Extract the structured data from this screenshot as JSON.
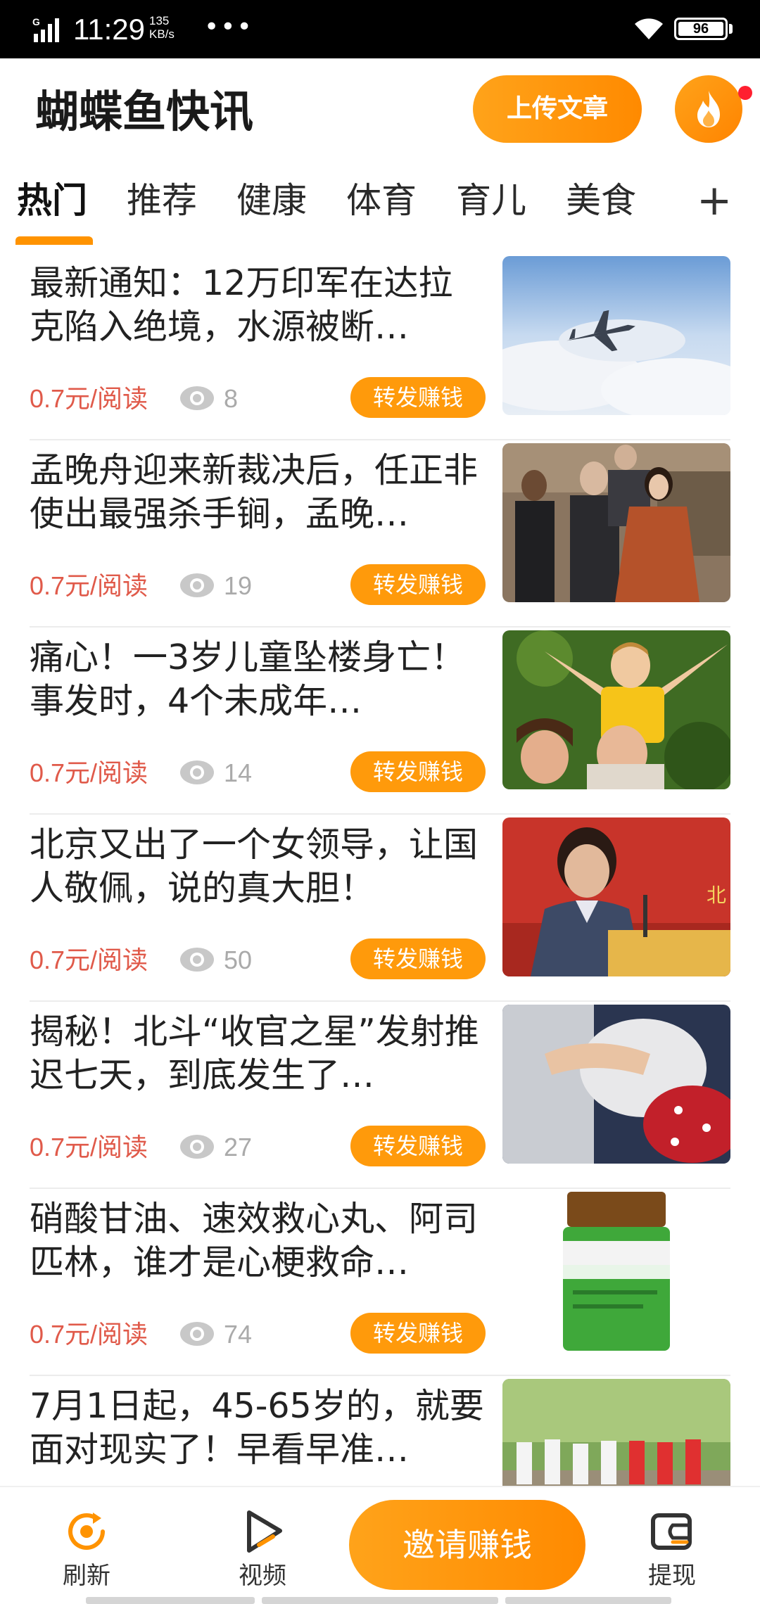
{
  "status_bar": {
    "time": "11:29",
    "speed": "135 KB/s",
    "more": "•••",
    "battery": "96"
  },
  "header": {
    "title": "蝴蝶鱼快讯",
    "upload_label": "上传文章"
  },
  "tabs": [
    {
      "label": "热门",
      "active": true
    },
    {
      "label": "推荐",
      "active": false
    },
    {
      "label": "健康",
      "active": false
    },
    {
      "label": "体育",
      "active": false
    },
    {
      "label": "育儿",
      "active": false
    },
    {
      "label": "美食",
      "active": false
    }
  ],
  "tab_add_label": "+",
  "feed": [
    {
      "title": "最新通知：12万印军在达拉克陷入绝境，水源被断…",
      "price": "0.7元/阅读",
      "views": "8",
      "share": "转发赚钱",
      "image": "fighter jet in cloudy sky"
    },
    {
      "title": "孟晚舟迎来新裁决后，任正非使出最强杀手锏，孟晚…",
      "price": "0.7元/阅读",
      "views": "19",
      "share": "转发赚钱",
      "image": "group of people walking"
    },
    {
      "title": "痛心！一3岁儿童坠楼身亡！事发时，4个未成年…",
      "price": "0.7元/阅读",
      "views": "14",
      "share": "转发赚钱",
      "image": "happy family with child"
    },
    {
      "title": "北京又出了一个女领导，让国人敬佩，说的真大胆！",
      "price": "0.7元/阅读",
      "views": "50",
      "share": "转发赚钱",
      "image": "woman speaking at podium"
    },
    {
      "title": "揭秘！北斗“收官之星”发射推迟七天，到底发生了…",
      "price": "0.7元/阅读",
      "views": "27",
      "share": "转发赚钱",
      "image": "hands on satellite equipment"
    },
    {
      "title": "硝酸甘油、速效救心丸、阿司匹林，谁才是心梗救命…",
      "price": "0.7元/阅读",
      "views": "74",
      "share": "转发赚钱",
      "image": "medicine bottle"
    },
    {
      "title": "7月1日起，45-65岁的，就要面对现实了！早看早准…",
      "price": "",
      "views": "",
      "share": "",
      "image": "people practicing tai chi"
    }
  ],
  "bottom_nav": {
    "refresh_label": "刷新",
    "video_label": "视频",
    "invite_label": "邀请赚钱",
    "withdraw_label": "提现"
  },
  "colors": {
    "accent": "#ff9300",
    "price": "#e05a4a",
    "dot": "#ff1f2f"
  }
}
